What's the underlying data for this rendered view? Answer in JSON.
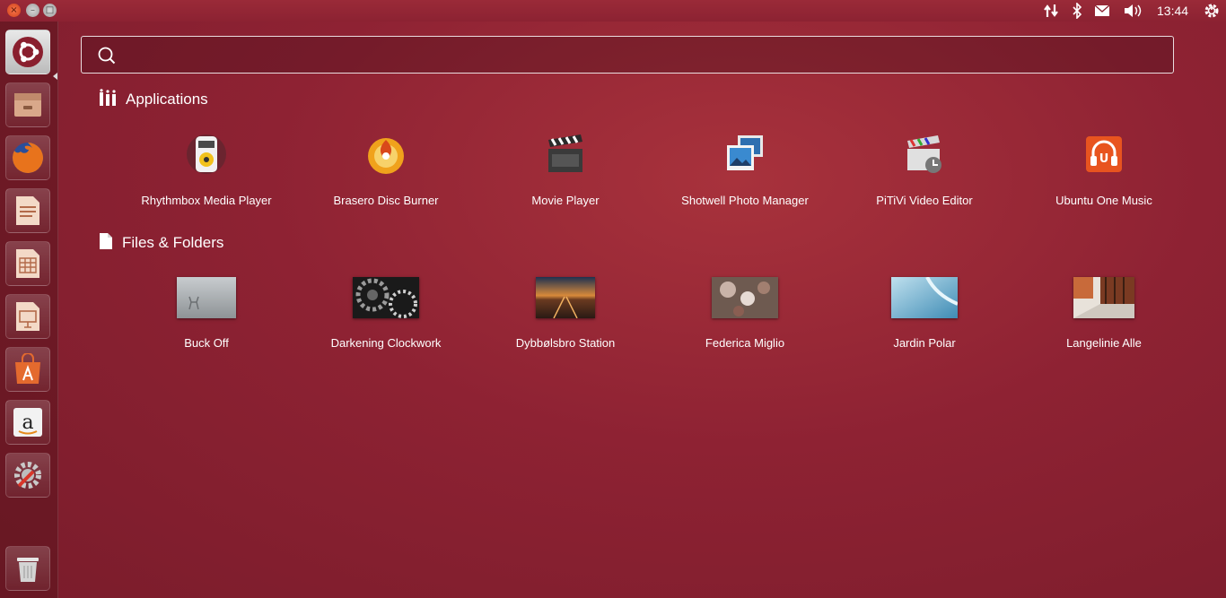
{
  "window_controls": {
    "close": "×",
    "minimize": "–",
    "maximize": "□"
  },
  "panel": {
    "clock": "13:44",
    "indicators": [
      "network-icon",
      "bluetooth-icon",
      "mail-icon",
      "volume-icon",
      "session-gear-icon"
    ]
  },
  "launcher": {
    "items": [
      "ubuntu-dash-icon",
      "file-manager-icon",
      "firefox-icon",
      "writer-icon",
      "calc-icon",
      "impress-icon",
      "software-center-icon",
      "amazon-icon",
      "system-settings-icon"
    ],
    "trash": "trash-icon"
  },
  "search": {
    "value": "",
    "placeholder": ""
  },
  "sections": {
    "applications": {
      "title": "Applications",
      "items": [
        {
          "label": "Rhythmbox Media Player",
          "icon": "rhythmbox-icon"
        },
        {
          "label": "Brasero Disc Burner",
          "icon": "brasero-icon"
        },
        {
          "label": "Movie Player",
          "icon": "movie-player-icon"
        },
        {
          "label": "Shotwell Photo Manager",
          "icon": "shotwell-icon"
        },
        {
          "label": "PiTiVi Video Editor",
          "icon": "pitivi-icon"
        },
        {
          "label": "Ubuntu One Music",
          "icon": "ubuntu-one-music-icon"
        }
      ]
    },
    "files": {
      "title": "Files & Folders",
      "items": [
        {
          "label": "Buck Off"
        },
        {
          "label": "Darkening Clockwork"
        },
        {
          "label": "Dybbølsbro Station"
        },
        {
          "label": "Federica Miglio"
        },
        {
          "label": "Jardin Polar"
        },
        {
          "label": "Langelinie Alle"
        }
      ]
    }
  },
  "colors": {
    "accent": "#e95420",
    "background": "#8e2233"
  }
}
